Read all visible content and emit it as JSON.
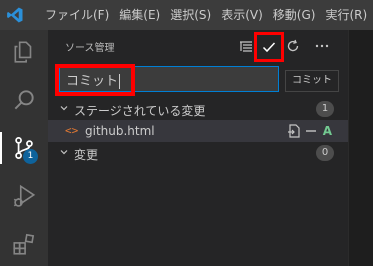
{
  "titlebar": {
    "menu": [
      "ファイル(F)",
      "編集(E)",
      "選択(S)",
      "表示(V)",
      "移動(G)",
      "実行(R)"
    ]
  },
  "activitybar": {
    "items": [
      {
        "name": "explorer",
        "icon": "files-icon"
      },
      {
        "name": "search",
        "icon": "search-icon"
      },
      {
        "name": "source-control",
        "icon": "source-control-icon",
        "badge": "1"
      },
      {
        "name": "run-debug",
        "icon": "run-debug-icon"
      },
      {
        "name": "extensions",
        "icon": "extensions-icon"
      }
    ]
  },
  "scm": {
    "title": "ソース管理",
    "message_value": "コミット",
    "commit_tooltip": "コミット",
    "staged_group": {
      "label": "ステージされている変更",
      "count": "1"
    },
    "staged_file": {
      "icon_text": "<>",
      "name": "github.html",
      "status": "A"
    },
    "changes_group": {
      "label": "変更",
      "count": "0"
    }
  },
  "colors": {
    "highlight": "#ff0000",
    "accent": "#007fd4",
    "added": "#73c991"
  }
}
